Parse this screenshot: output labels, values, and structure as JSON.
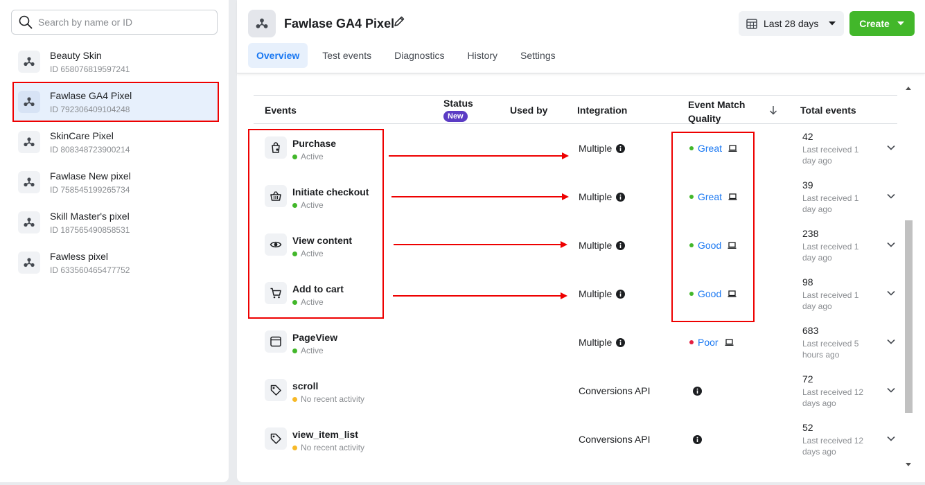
{
  "sidebar": {
    "search_placeholder": "Search by name or ID",
    "pixels": [
      {
        "name": "Beauty Skin",
        "id": "ID 658076819597241"
      },
      {
        "name": "Fawlase GA4 Pixel",
        "id": "ID 792306409104248"
      },
      {
        "name": "SkinCare Pixel",
        "id": "ID 808348723900214"
      },
      {
        "name": "Fawlase New pixel",
        "id": "ID 758545199265734"
      },
      {
        "name": "Skill Master's pixel",
        "id": "ID 187565490858531"
      },
      {
        "name": "Fawless pixel",
        "id": "ID 633560465477752"
      }
    ]
  },
  "header": {
    "title": "Fawlase GA4 Pixel",
    "date_range": "Last 28 days",
    "create_label": "Create",
    "tabs": [
      "Overview",
      "Test events",
      "Diagnostics",
      "History",
      "Settings"
    ]
  },
  "table": {
    "columns": {
      "events": "Events",
      "status": "Status",
      "status_badge": "New",
      "used_by": "Used by",
      "integration": "Integration",
      "emq_line1": "Event Match",
      "emq_line2": "Quality",
      "total": "Total events"
    },
    "rows": [
      {
        "name": "Purchase",
        "status": "Active",
        "integration": "Multiple",
        "emq": "Great",
        "total": "42",
        "last": "Last received 1 day ago"
      },
      {
        "name": "Initiate checkout",
        "status": "Active",
        "integration": "Multiple",
        "emq": "Great",
        "total": "39",
        "last": "Last received 1 day ago"
      },
      {
        "name": "View content",
        "status": "Active",
        "integration": "Multiple",
        "emq": "Good",
        "total": "238",
        "last": "Last received 1 day ago"
      },
      {
        "name": "Add to cart",
        "status": "Active",
        "integration": "Multiple",
        "emq": "Good",
        "total": "98",
        "last": "Last received 1 day ago"
      },
      {
        "name": "PageView",
        "status": "Active",
        "integration": "Multiple",
        "emq": "Poor",
        "total": "683",
        "last": "Last received 5 hours ago"
      },
      {
        "name": "scroll",
        "status": "No recent activity",
        "integration": "Conversions API",
        "emq": "",
        "total": "72",
        "last": "Last received 12 days ago"
      },
      {
        "name": "view_item_list",
        "status": "No recent activity",
        "integration": "Conversions API",
        "emq": "",
        "total": "52",
        "last": "Last received 12 days ago"
      }
    ]
  },
  "colors": {
    "active": "#42b72a",
    "no_activity": "#f7b928",
    "great": "#42b72a",
    "poor": "#e41e3f",
    "accent": "#1877f2",
    "create": "#42b72a",
    "annotation": "#e00000"
  }
}
